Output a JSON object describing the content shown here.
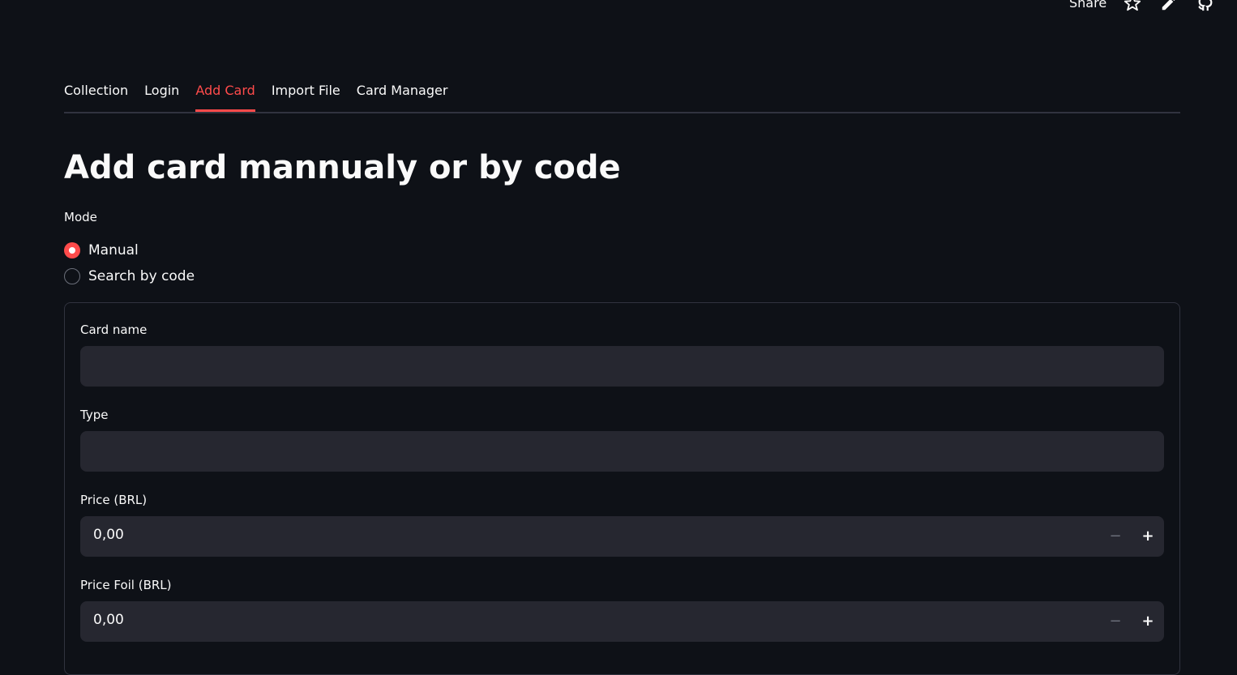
{
  "header": {
    "share_label": "Share"
  },
  "tabs": [
    {
      "label": "Collection"
    },
    {
      "label": "Login"
    },
    {
      "label": "Add Card"
    },
    {
      "label": "Import File"
    },
    {
      "label": "Card Manager"
    }
  ],
  "active_tab": "Add Card",
  "page": {
    "title": "Add card mannualy or by code"
  },
  "mode": {
    "label": "Mode",
    "options": [
      "Manual",
      "Search by code"
    ],
    "selected": "Manual"
  },
  "form": {
    "card_name": {
      "label": "Card name",
      "value": ""
    },
    "type": {
      "label": "Type",
      "value": ""
    },
    "price": {
      "label": "Price (BRL)",
      "value": "0,00",
      "minus": "−",
      "plus": "+"
    },
    "price_foil": {
      "label": "Price Foil (BRL)",
      "value": "0,00",
      "minus": "−",
      "plus": "+"
    }
  },
  "colors": {
    "background": "#0e1117",
    "accent": "#ff4b4b",
    "input_bg": "#262730",
    "border": "#31333f"
  },
  "icons": [
    "star-icon",
    "pencil-icon",
    "github-icon"
  ]
}
